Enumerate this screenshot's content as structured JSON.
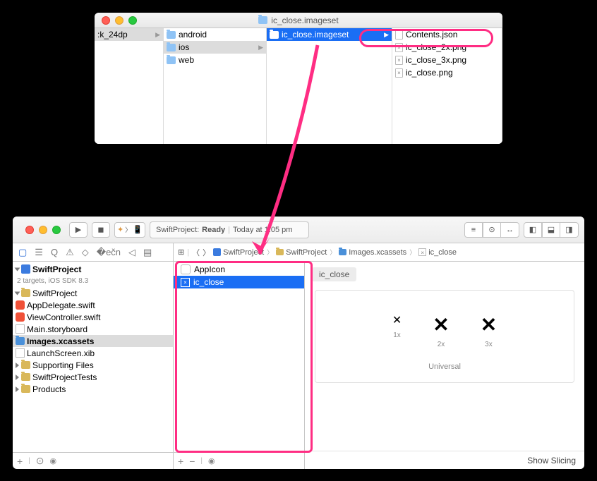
{
  "finder": {
    "title": "ic_close.imageset",
    "col0": {
      "item": ":k_24dp"
    },
    "col1": {
      "items": [
        "android",
        "ios",
        "web"
      ]
    },
    "col2": {
      "item": "ic_close.imageset"
    },
    "col3": {
      "items": [
        "Contents.json",
        "ic_close_2x.png",
        "ic_close_3x.png",
        "ic_close.png"
      ]
    }
  },
  "xcode": {
    "toolbar": {
      "status_project": "SwiftProject:",
      "status_state": "Ready",
      "status_sep": "|",
      "status_time": "Today at 1:05 pm"
    },
    "nav": {
      "root": "SwiftProject",
      "root_sub": "2 targets, iOS SDK 8.3",
      "group_app": "SwiftProject",
      "files": {
        "appdelegate": "AppDelegate.swift",
        "viewcontroller": "ViewController.swift",
        "mainsb": "Main.storyboard",
        "images": "Images.xcassets",
        "launch": "LaunchScreen.xib",
        "supporting": "Supporting Files"
      },
      "group_tests": "SwiftProjectTests",
      "group_products": "Products"
    },
    "jump": {
      "s0": "SwiftProject",
      "s1": "SwiftProject",
      "s2": "Images.xcassets",
      "s3": "ic_close"
    },
    "assets": {
      "appicon": "AppIcon",
      "ic_close": "ic_close"
    },
    "canvas": {
      "title": "ic_close",
      "l1": "1x",
      "l2": "2x",
      "l3": "3x",
      "universal": "Universal",
      "slicing": "Show Slicing"
    }
  }
}
